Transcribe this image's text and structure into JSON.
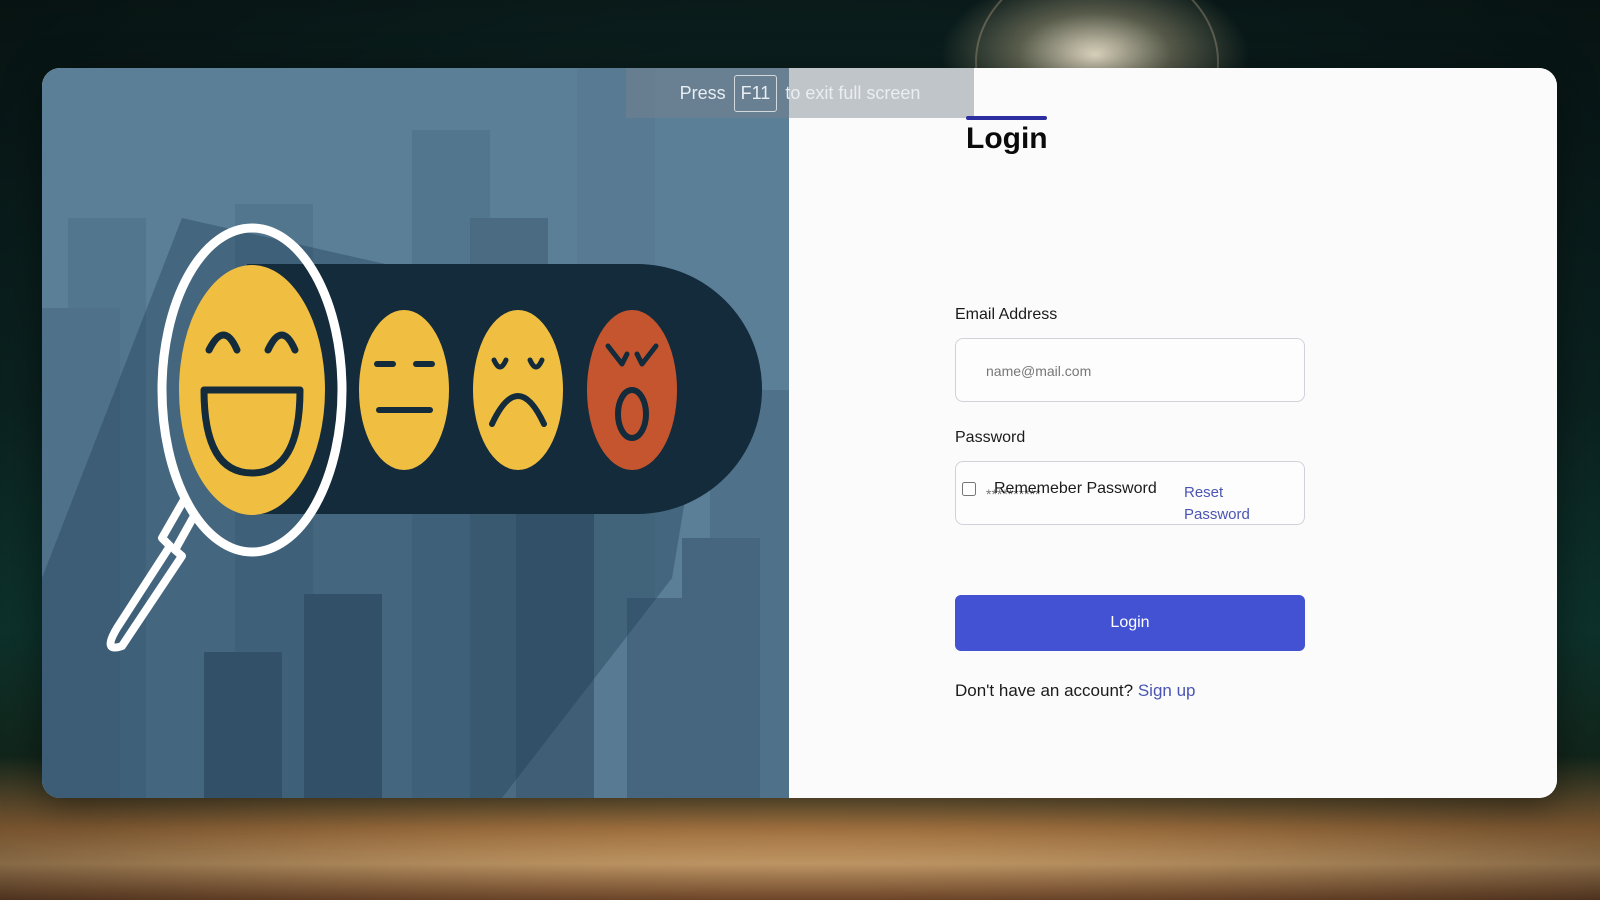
{
  "overlay": {
    "press_text": "Press",
    "key_label": "F11",
    "suffix_text": "to exit full screen"
  },
  "illustration": {
    "faces": [
      "happy-face",
      "neutral-face",
      "sad-face",
      "angry-face"
    ],
    "colors": {
      "face_yellow": "#f0bf41",
      "face_red": "#c4552e",
      "bar_dark": "#132b3b",
      "panel_bg": "#5b7f97"
    }
  },
  "login": {
    "title": "Login",
    "email_label": "Email Address",
    "email_placeholder": "name@mail.com",
    "password_label": "Password",
    "password_placeholder": "**********",
    "reset_link": "Reset Password",
    "remember_label": "Rememeber Password",
    "remember_checked": false,
    "button_label": "Login",
    "no_account_text": "Don't have an account?",
    "signup_link": "Sign up",
    "accent_color": "#4252d2"
  }
}
